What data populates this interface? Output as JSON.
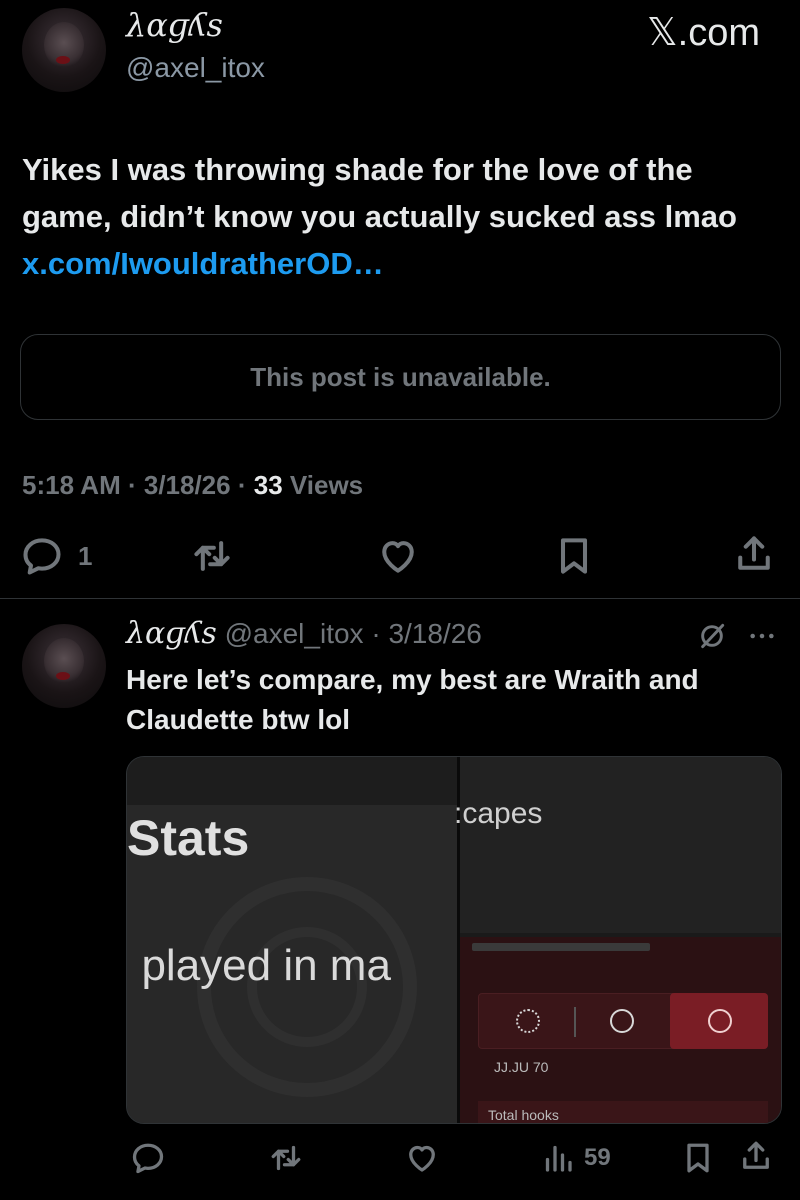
{
  "brand": {
    "logo_text": "𝕏.com"
  },
  "main_post": {
    "display_name": "λɑɡʎs",
    "handle": "@axel_itox",
    "text_before_link": "Yikes I was throwing shade for the love of the game, didn’t know you actually sucked ass lmao ",
    "link_text": "x.com/IwouldratherOD…",
    "quoted_unavailable": "This post is unavailable.",
    "time": "5:18 AM",
    "date": "3/18/26",
    "views_count": "33",
    "views_label": "Views",
    "reply_count": "1"
  },
  "reply_post": {
    "display_name": "λɑɡʎs",
    "handle": "@axel_itox",
    "date": "3/18/26",
    "text": "Here let’s compare, my best are Wraith and Claudette btw lol",
    "views_count": "59",
    "media": {
      "left_title": "Stats",
      "left_subtitle": "; played in ma",
      "right_title": ":capes",
      "percent_text": "JJ.JU 70",
      "total_label": "Total hooks"
    }
  },
  "colors": {
    "accent": "#1d9bf0",
    "muted": "#71767b",
    "background": "#000000"
  }
}
